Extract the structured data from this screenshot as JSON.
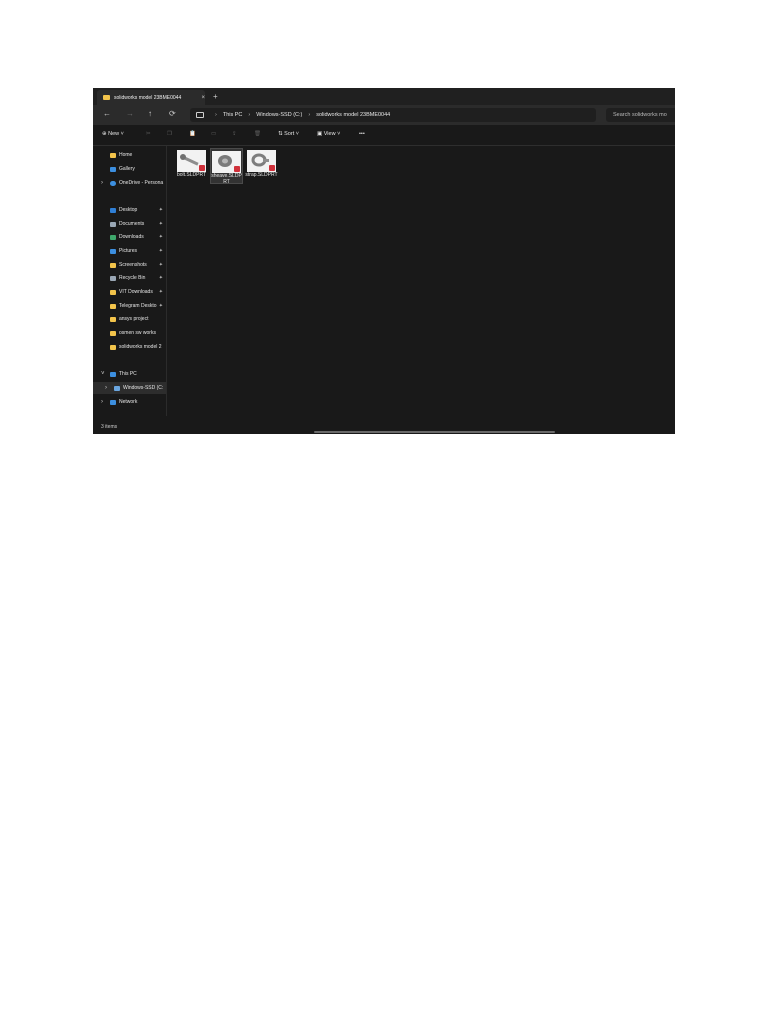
{
  "window": {
    "tab_title": "solidworks model 23BME0044",
    "tab_close": "×",
    "new_tab": "+"
  },
  "nav": {
    "back": "←",
    "forward": "→",
    "up": "↑",
    "refresh": "⟳"
  },
  "breadcrumb": {
    "items": [
      "This PC",
      "Windows-SSD (C:)",
      "solidworks model 23BME0044"
    ],
    "separator": "›"
  },
  "search": {
    "placeholder": "Search solidworks mo"
  },
  "toolbar": {
    "new_label": "New",
    "sort_label": "Sort",
    "view_label": "View",
    "more_label": "•••"
  },
  "sidebar": {
    "items": [
      {
        "label": "Home",
        "icon": "home-icon",
        "color": "#f3c44b"
      },
      {
        "label": "Gallery",
        "icon": "gallery-icon",
        "color": "#3c8fe0"
      },
      {
        "label": "OneDrive - Persona",
        "icon": "cloud-icon",
        "color": "#3c8fe0"
      },
      {
        "label": "Desktop",
        "icon": "desktop-icon",
        "color": "#2f7fd6"
      },
      {
        "label": "Documents",
        "icon": "documents-icon",
        "color": "#9aa7b5"
      },
      {
        "label": "Downloads",
        "icon": "download-icon",
        "color": "#3ea76b"
      },
      {
        "label": "Pictures",
        "icon": "pictures-icon",
        "color": "#3c8fe0"
      },
      {
        "label": "Screenshots",
        "icon": "folder-icon",
        "color": "#f3c44b"
      },
      {
        "label": "Recycle Bin",
        "icon": "recycle-bin-icon",
        "color": "#9aa7b5"
      },
      {
        "label": "VIT Downloads",
        "icon": "folder-icon",
        "color": "#f3c44b"
      },
      {
        "label": "Telegram Deskto",
        "icon": "folder-icon",
        "color": "#f3c44b"
      },
      {
        "label": "ansys project",
        "icon": "folder-icon",
        "color": "#f3c44b"
      },
      {
        "label": "osmen sw works",
        "icon": "folder-icon",
        "color": "#f3c44b"
      },
      {
        "label": "solidworks model 2",
        "icon": "folder-icon",
        "color": "#f3c44b"
      },
      {
        "label": "This PC",
        "icon": "pc-icon",
        "color": "#3c8fe0"
      },
      {
        "label": "Windows-SSD (C:",
        "icon": "drive-icon",
        "color": "#6aa6e0"
      },
      {
        "label": "Network",
        "icon": "network-icon",
        "color": "#3c8fe0"
      }
    ],
    "pin": "📌"
  },
  "files": [
    {
      "name": "bolt.SLDPRT"
    },
    {
      "name": "sheave.SLDPRT"
    },
    {
      "name": "strap.SLDPRT"
    }
  ],
  "status": {
    "count": "3 items"
  }
}
